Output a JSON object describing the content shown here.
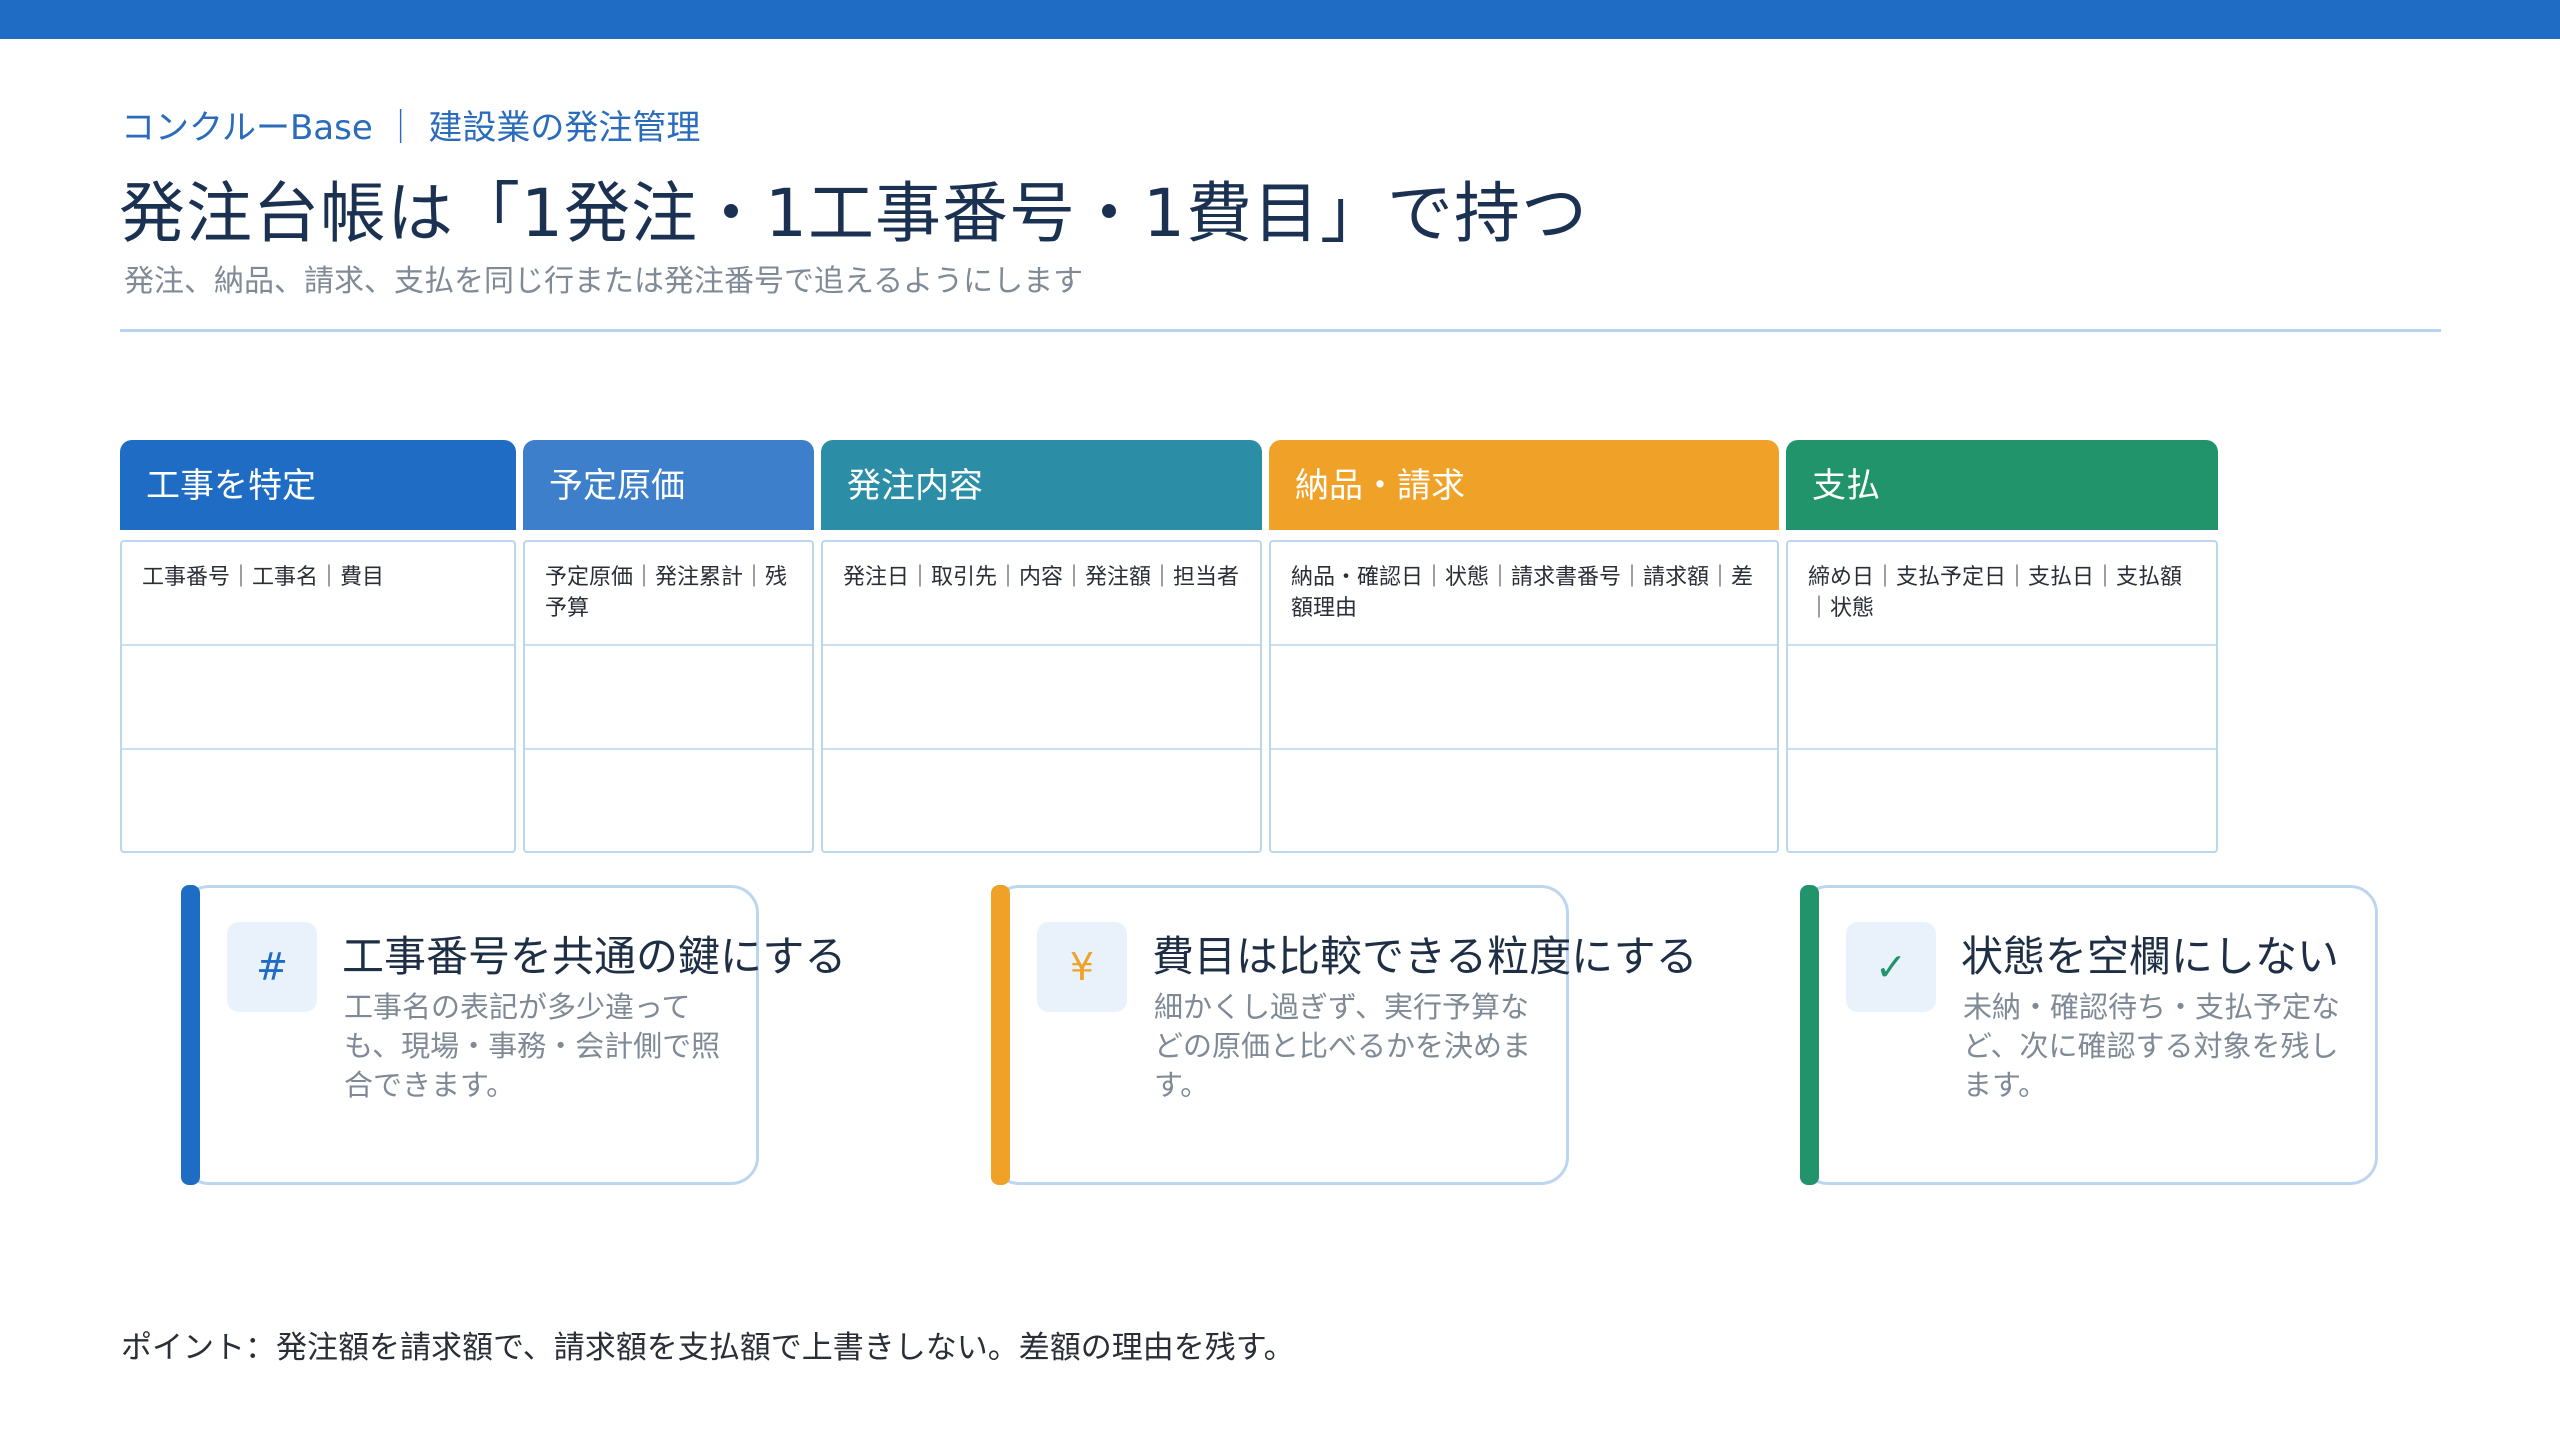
{
  "header": {
    "breadcrumb": "コンクルーBase ｜ 建設業の発注管理",
    "title": "発注台帳は「1発注・1工事番号・1費目」で持つ",
    "subtitle": "発注、納品、請求、支払を同じ行または発注番号で追えるようにします"
  },
  "columns": [
    {
      "label": "工事を特定",
      "color": "#1f6cc4",
      "fields": "工事番号｜工事名｜費目"
    },
    {
      "label": "予定原価",
      "color": "#3d7fcb",
      "fields": "予定原価｜発注累計｜残予算"
    },
    {
      "label": "発注内容",
      "color": "#2b8ea6",
      "fields": "発注日｜取引先｜内容｜発注額｜担当者"
    },
    {
      "label": "納品・請求",
      "color": "#f0a128",
      "fields": "納品・確認日｜状態｜請求書番号｜請求額｜差額理由"
    },
    {
      "label": "支払",
      "color": "#22946c",
      "fields": "締め日｜支払予定日｜支払日｜支払額｜状態"
    }
  ],
  "cards": [
    {
      "icon": "#",
      "icon_name": "hash-icon",
      "accent": "#1f6cc4",
      "title": "工事番号を共通の鍵にする",
      "text": "工事名の表記が多少違っても、現場・事務・会計側で照合できます。"
    },
    {
      "icon": "¥",
      "icon_name": "yen-icon",
      "accent": "#f0a128",
      "title": "費目は比較できる粒度にする",
      "text": "細かくし過ぎず、実行予算などの原価と比べるかを決めます。"
    },
    {
      "icon": "✓",
      "icon_name": "check-icon",
      "accent": "#22946c",
      "title": "状態を空欄にしない",
      "text": "未納・確認待ち・支払予定など、次に確認する対象を残します。"
    }
  ],
  "footer": {
    "point": "ポイント：発注額を請求額で、請求額を支払額で上書きしない。差額の理由を残す。"
  }
}
